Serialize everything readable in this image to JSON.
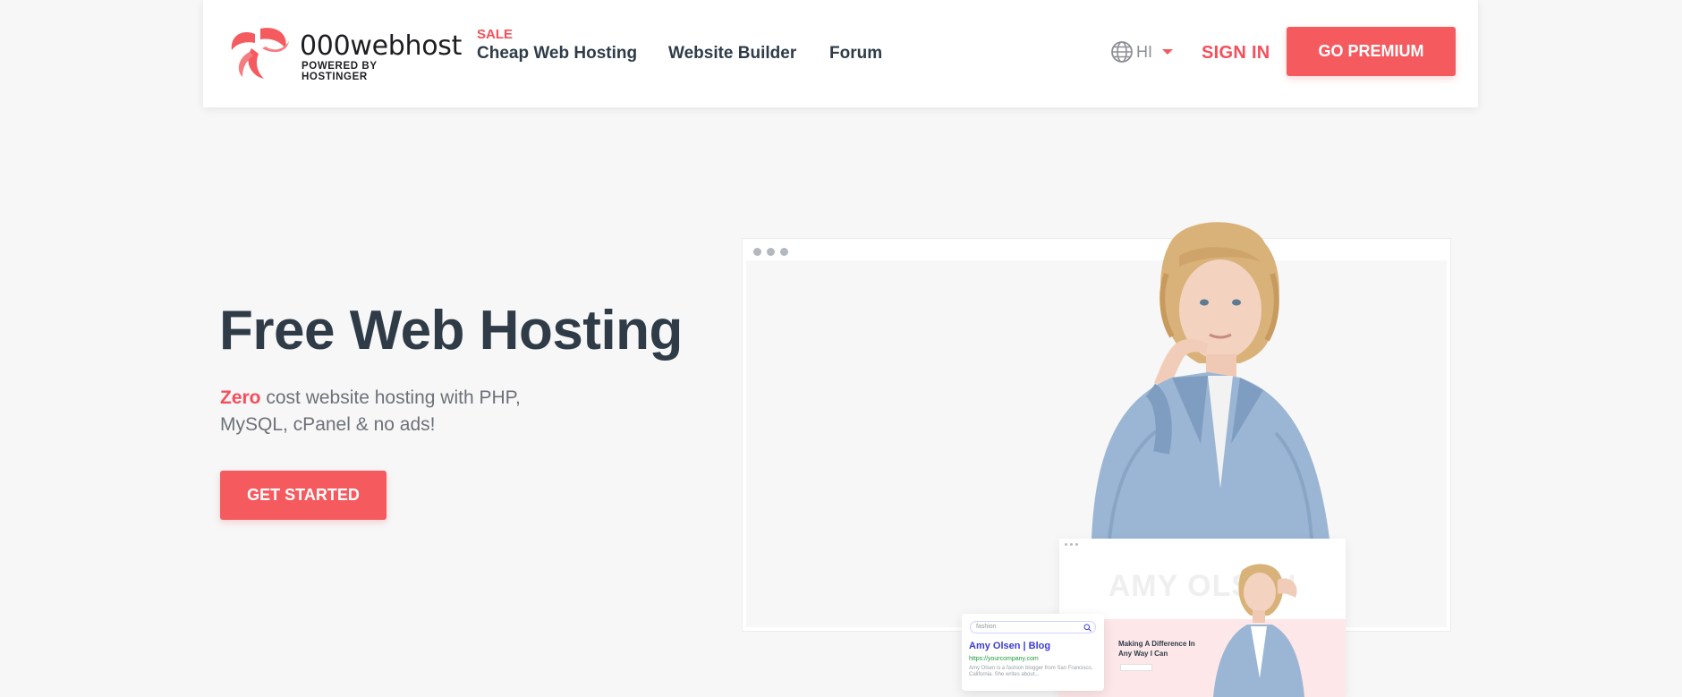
{
  "header": {
    "logo": {
      "name": "000webhost",
      "tagline": "POWERED BY HOSTINGER"
    },
    "nav": {
      "sale_badge": "SALE",
      "cheap_hosting": "Cheap Web Hosting",
      "website_builder": "Website Builder",
      "forum": "Forum"
    },
    "language": {
      "icon": "globe-icon",
      "code": "HI"
    },
    "sign_in": "SIGN IN",
    "premium_button": "GO PREMIUM"
  },
  "hero": {
    "title": "Free Web Hosting",
    "subtitle_accent": "Zero",
    "subtitle_rest": " cost website hosting with PHP, MySQL, cPanel & no ads!",
    "cta": "GET STARTED"
  },
  "illustration": {
    "site_heading": "AMY OLSEN",
    "site_tagline": "Making A Difference In Any Way I Can",
    "search_placeholder": "fashion",
    "search_result_title": "Amy Olsen | Blog",
    "search_result_url": "https://yourcompany.com",
    "search_result_desc": "Amy Olsen is a fashion blogger from San Francisco, California. She writes about..."
  },
  "colors": {
    "accent": "#f55a5f",
    "text_dark": "#2f3c48",
    "text_muted": "#6d7178",
    "background": "#f7f7f7"
  }
}
